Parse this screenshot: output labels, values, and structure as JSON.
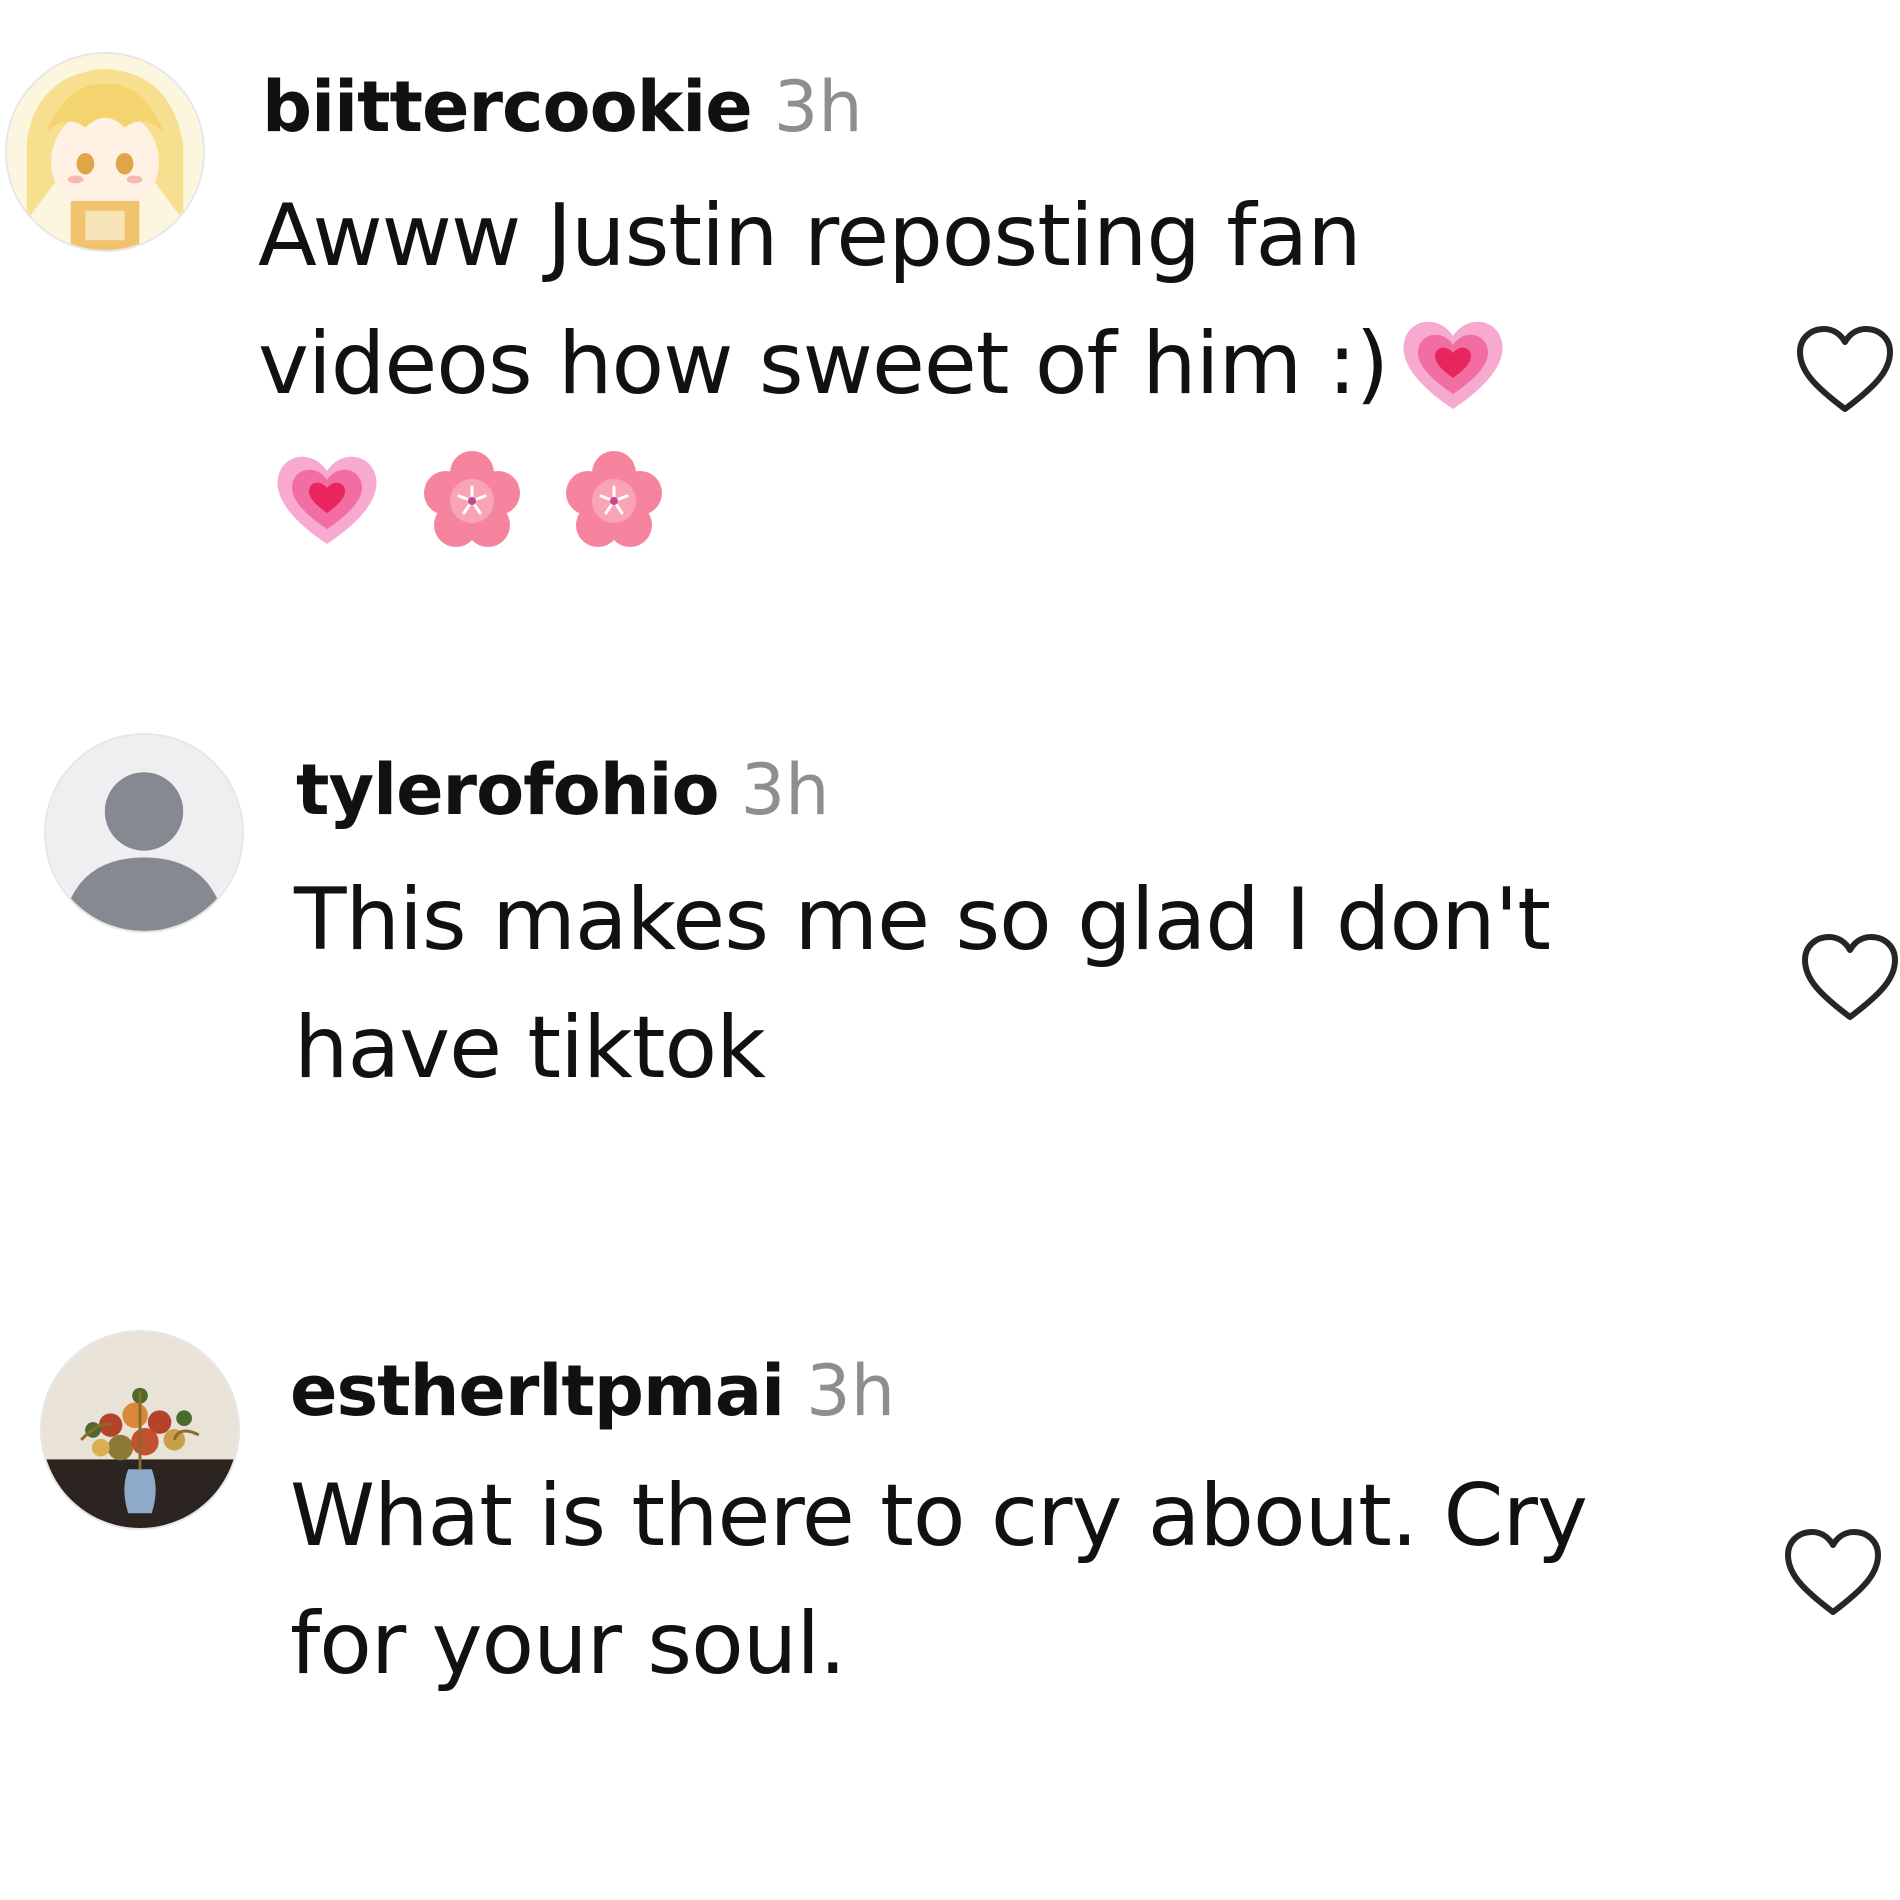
{
  "comments": [
    {
      "username": "biittercookie",
      "time": "3h",
      "line1": "Awww Justin reposting fan",
      "line2": "videos how sweet of him :)",
      "emojis_inline": [
        "growing-heart-emoji"
      ],
      "emojis_line3": [
        "growing-heart-emoji",
        "cherry-blossom-emoji",
        "cherry-blossom-emoji"
      ],
      "avatar": "anime-girl-avatar"
    },
    {
      "username": "tylerofohio",
      "time": "3h",
      "line1": "This makes me so glad I don't",
      "line2": "have tiktok",
      "avatar": "default-user-avatar"
    },
    {
      "username": "estherltpmai",
      "time": "3h",
      "line1": "What is there to cry about. Cry",
      "line2": "for your soul.",
      "avatar": "flower-vase-avatar"
    }
  ],
  "icons": {
    "like": "heart-outline-icon"
  },
  "colors": {
    "text": "#111111",
    "muted": "#8e8e8e",
    "icon_stroke": "#262626",
    "pink": "#f25f8e"
  }
}
